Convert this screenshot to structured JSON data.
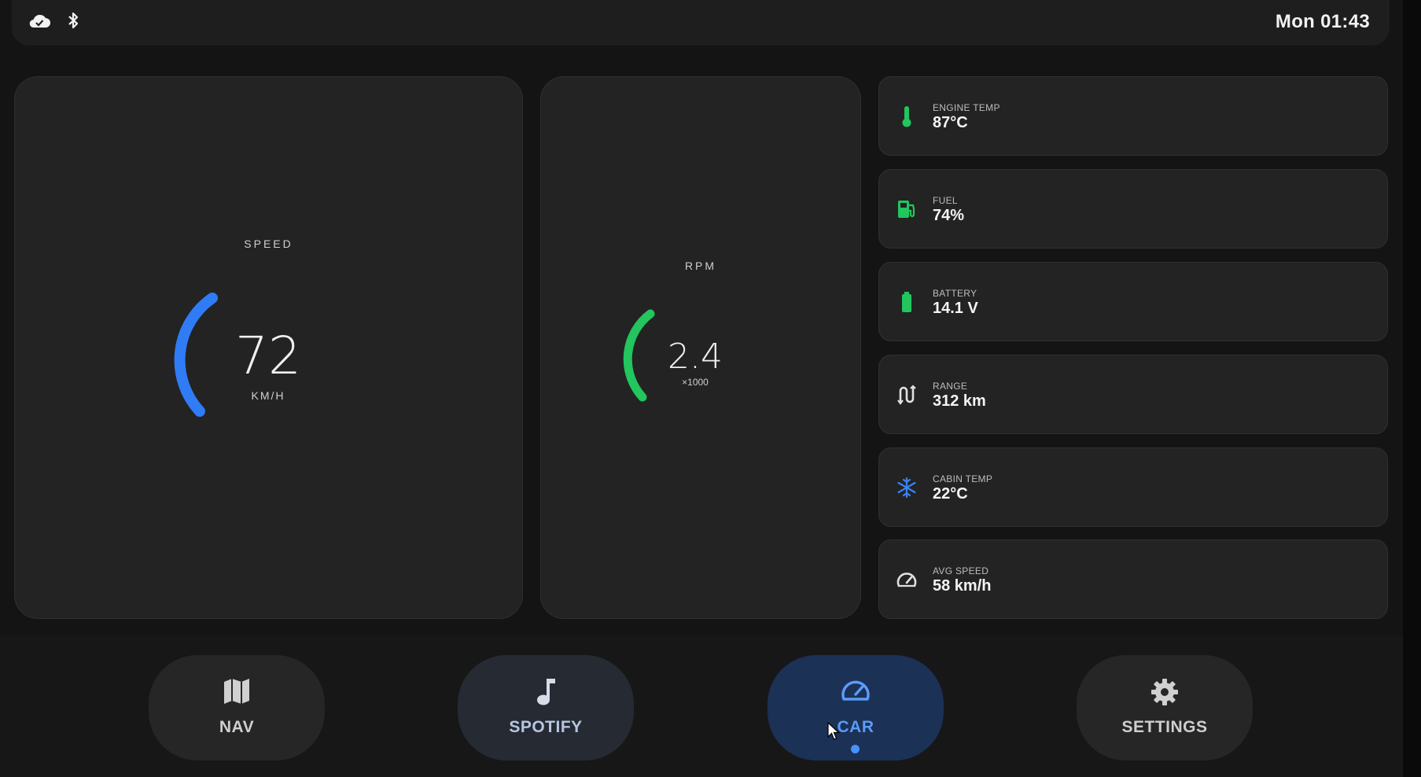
{
  "status_bar": {
    "icons": [
      "cloud-done-icon",
      "bluetooth-icon"
    ],
    "clock": "Mon 01:43"
  },
  "speed_gauge": {
    "title": "SPEED",
    "value": "72",
    "unit": "KM/H",
    "color": "#2f7cf6"
  },
  "rpm_gauge": {
    "title": "RPM",
    "value": "2.4",
    "unit": "×1000",
    "color": "#22c55e"
  },
  "tiles": [
    {
      "icon": "thermometer-icon",
      "icon_color": "#22c55e",
      "label": "ENGINE TEMP",
      "value": "87°C"
    },
    {
      "icon": "fuel-pump-icon",
      "icon_color": "#22c55e",
      "label": "FUEL",
      "value": "74%"
    },
    {
      "icon": "battery-icon",
      "icon_color": "#22c55e",
      "label": "BATTERY",
      "value": "14.1 V"
    },
    {
      "icon": "route-icon",
      "icon_color": "#e0e0e0",
      "label": "RANGE",
      "value": "312 km"
    },
    {
      "icon": "snowflake-icon",
      "icon_color": "#3b82f6",
      "label": "CABIN TEMP",
      "value": "22°C"
    },
    {
      "icon": "speedometer-icon",
      "icon_color": "#e0e0e0",
      "label": "AVG SPEED",
      "value": "58 km/h"
    }
  ],
  "nav": {
    "items": [
      {
        "icon": "map-icon",
        "label": "NAV"
      },
      {
        "icon": "music-note-icon",
        "label": "SPOTIFY"
      },
      {
        "icon": "speedometer-icon",
        "label": "CAR",
        "active": true
      },
      {
        "icon": "gear-icon",
        "label": "SETTINGS"
      }
    ],
    "accent": "#4a90ff"
  }
}
